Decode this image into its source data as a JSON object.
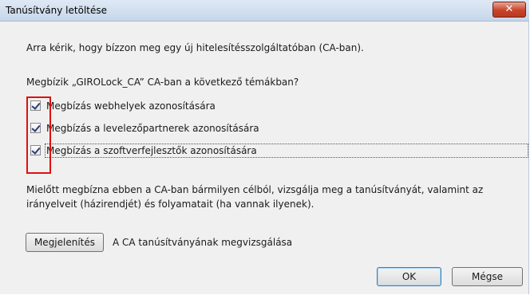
{
  "window": {
    "title": "Tanúsítvány letöltése",
    "close_label": "✕"
  },
  "dialog": {
    "intro": "Arra kérik, hogy bízzon meg egy új hitelesítésszolgáltatóban (CA-ban).",
    "question": "Megbízik „GIROLock_CA” CA-ban a következő témákban?",
    "options": [
      {
        "label": "Megbízás webhelyek azonosítására",
        "checked": true
      },
      {
        "label": "Megbízás a levelezőpartnerek azonosítására",
        "checked": true
      },
      {
        "label": "Megbízás a szoftverfejlesztők azonosítására",
        "checked": true
      }
    ],
    "note": "Mielőtt megbízna ebben a CA-ban bármilyen célból, vizsgálja meg a tanúsítványát, valamint az irányelveit (házirendjét) és folyamatait (ha vannak ilyenek).",
    "show_button": "Megjelenítés",
    "show_description": "A CA tanúsítványának megvizsgálása",
    "ok_button": "OK",
    "cancel_button": "Mégse"
  },
  "colors": {
    "highlight": "#e01010",
    "titlebar": "#c6d6ea",
    "close": "#c7442a"
  }
}
